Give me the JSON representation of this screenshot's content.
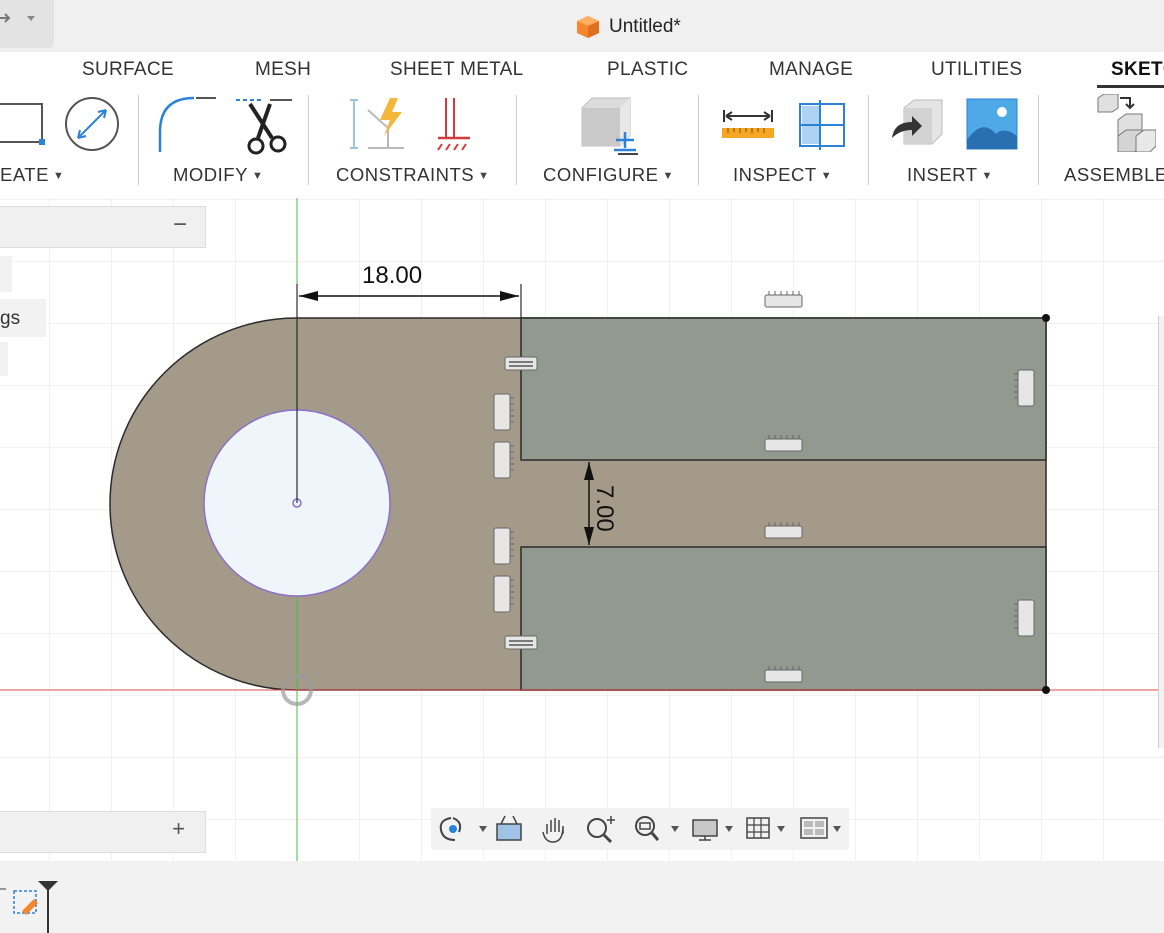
{
  "window": {
    "title": "Untitled*"
  },
  "ribbon": {
    "tabs": [
      {
        "label": "SURFACE"
      },
      {
        "label": "MESH"
      },
      {
        "label": "SHEET METAL"
      },
      {
        "label": "PLASTIC"
      },
      {
        "label": "MANAGE"
      },
      {
        "label": "UTILITIES"
      },
      {
        "label": "SKETC"
      }
    ],
    "groups": [
      {
        "label": "EATE"
      },
      {
        "label": "MODIFY"
      },
      {
        "label": "CONSTRAINTS"
      },
      {
        "label": "CONFIGURE"
      },
      {
        "label": "INSPECT"
      },
      {
        "label": "INSERT"
      },
      {
        "label": "ASSEMBLE"
      }
    ],
    "caret": "▼"
  },
  "browser": {
    "collapse_symbol": "−",
    "node_label": "gs",
    "comments_add_symbol": "+"
  },
  "sketch": {
    "dimension_horizontal": "18.00",
    "dimension_vertical": "7.00"
  },
  "colors": {
    "profile_fill": "#a49a89",
    "region_fill": "#929a8f",
    "hole_fill": "#eef6fc",
    "axis_green": "#44c244",
    "axis_red": "#e04a4a",
    "accent_orange": "#f5862b"
  },
  "navigation": {
    "tools": [
      "orbit-icon",
      "look-at-icon",
      "pan-icon",
      "zoom-icon",
      "fit-icon",
      "display-settings-icon",
      "grid-icon",
      "viewports-icon"
    ]
  }
}
